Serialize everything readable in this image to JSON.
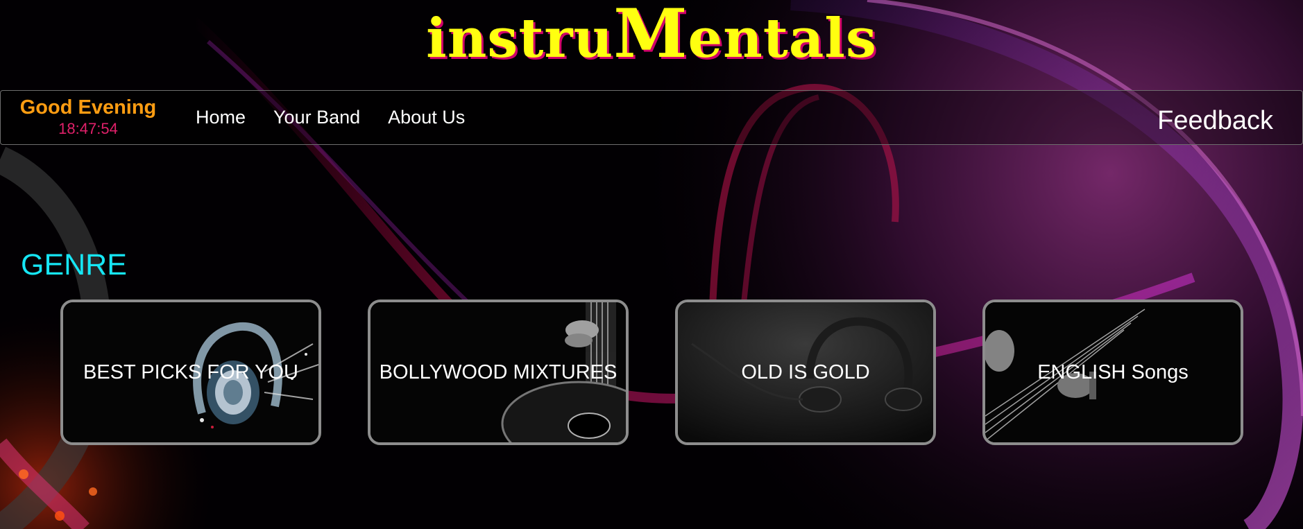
{
  "header": {
    "logo_prefix": "instru",
    "logo_big": "M",
    "logo_suffix": "entals"
  },
  "nav": {
    "greeting": "Good Evening",
    "time": "18:47:54",
    "links": [
      {
        "label": "Home"
      },
      {
        "label": "Your Band"
      },
      {
        "label": "About Us"
      }
    ],
    "feedback": "Feedback"
  },
  "genre": {
    "heading": "GENRE",
    "cards": [
      {
        "title": "BEST PICKS FOR YOU",
        "icon": "headphones-image"
      },
      {
        "title": "BOLLYWOOD MIXTURES",
        "icon": "guitar-image"
      },
      {
        "title": "OLD IS GOLD",
        "icon": "headphones-image"
      },
      {
        "title": "ENGLISH Songs",
        "icon": "guitar-strings-image"
      }
    ]
  },
  "colors": {
    "logo": "#ffff10",
    "logo_shadow": "#d0006a",
    "greeting": "#ff9d12",
    "clock": "#e0206a",
    "genre_heading": "#16e6f4",
    "card_border": "#8d8d8d"
  }
}
